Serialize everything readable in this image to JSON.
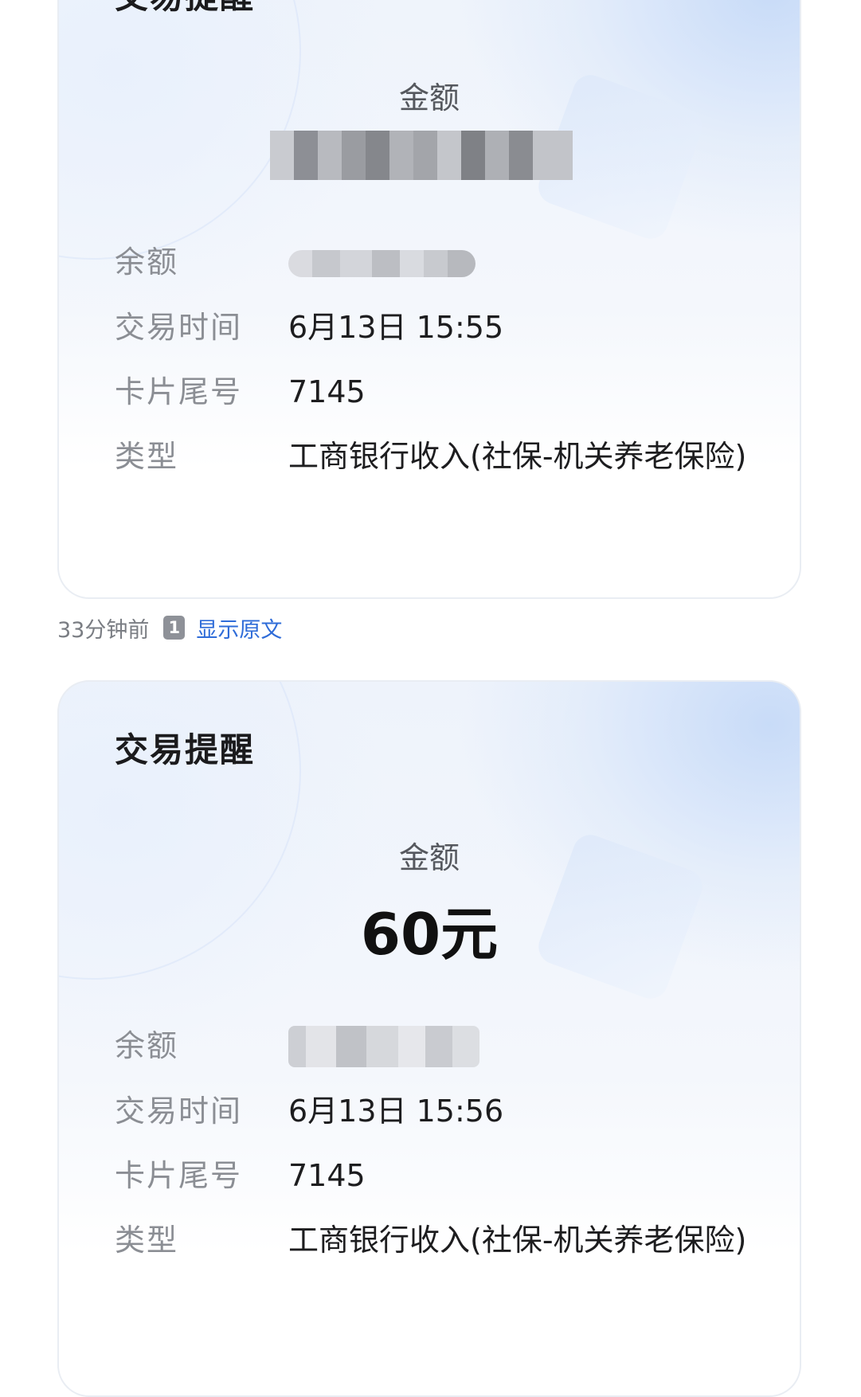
{
  "cards": [
    {
      "title": "交易提醒",
      "amount_label": "金额",
      "rows": [
        {
          "label": "余额",
          "value": ""
        },
        {
          "label": "交易时间",
          "value": "6月13日 15:55"
        },
        {
          "label": "卡片尾号",
          "value": "7145"
        },
        {
          "label": "类型",
          "value": "工商银行收入(社保-机关养老保险)"
        }
      ]
    },
    {
      "title": "交易提醒",
      "amount_label": "金额",
      "amount_value": "60元",
      "rows": [
        {
          "label": "余额",
          "value": ""
        },
        {
          "label": "交易时间",
          "value": "6月13日 15:56"
        },
        {
          "label": "卡片尾号",
          "value": "7145"
        },
        {
          "label": "类型",
          "value": "工商银行收入(社保-机关养老保险)"
        }
      ]
    }
  ],
  "meta": {
    "time_ago": "33分钟前",
    "sim_badge": "1",
    "show_original": "显示原文"
  },
  "colors": {
    "link": "#2f6cd8",
    "label": "#8b8e94",
    "text": "#1d1d1f"
  }
}
